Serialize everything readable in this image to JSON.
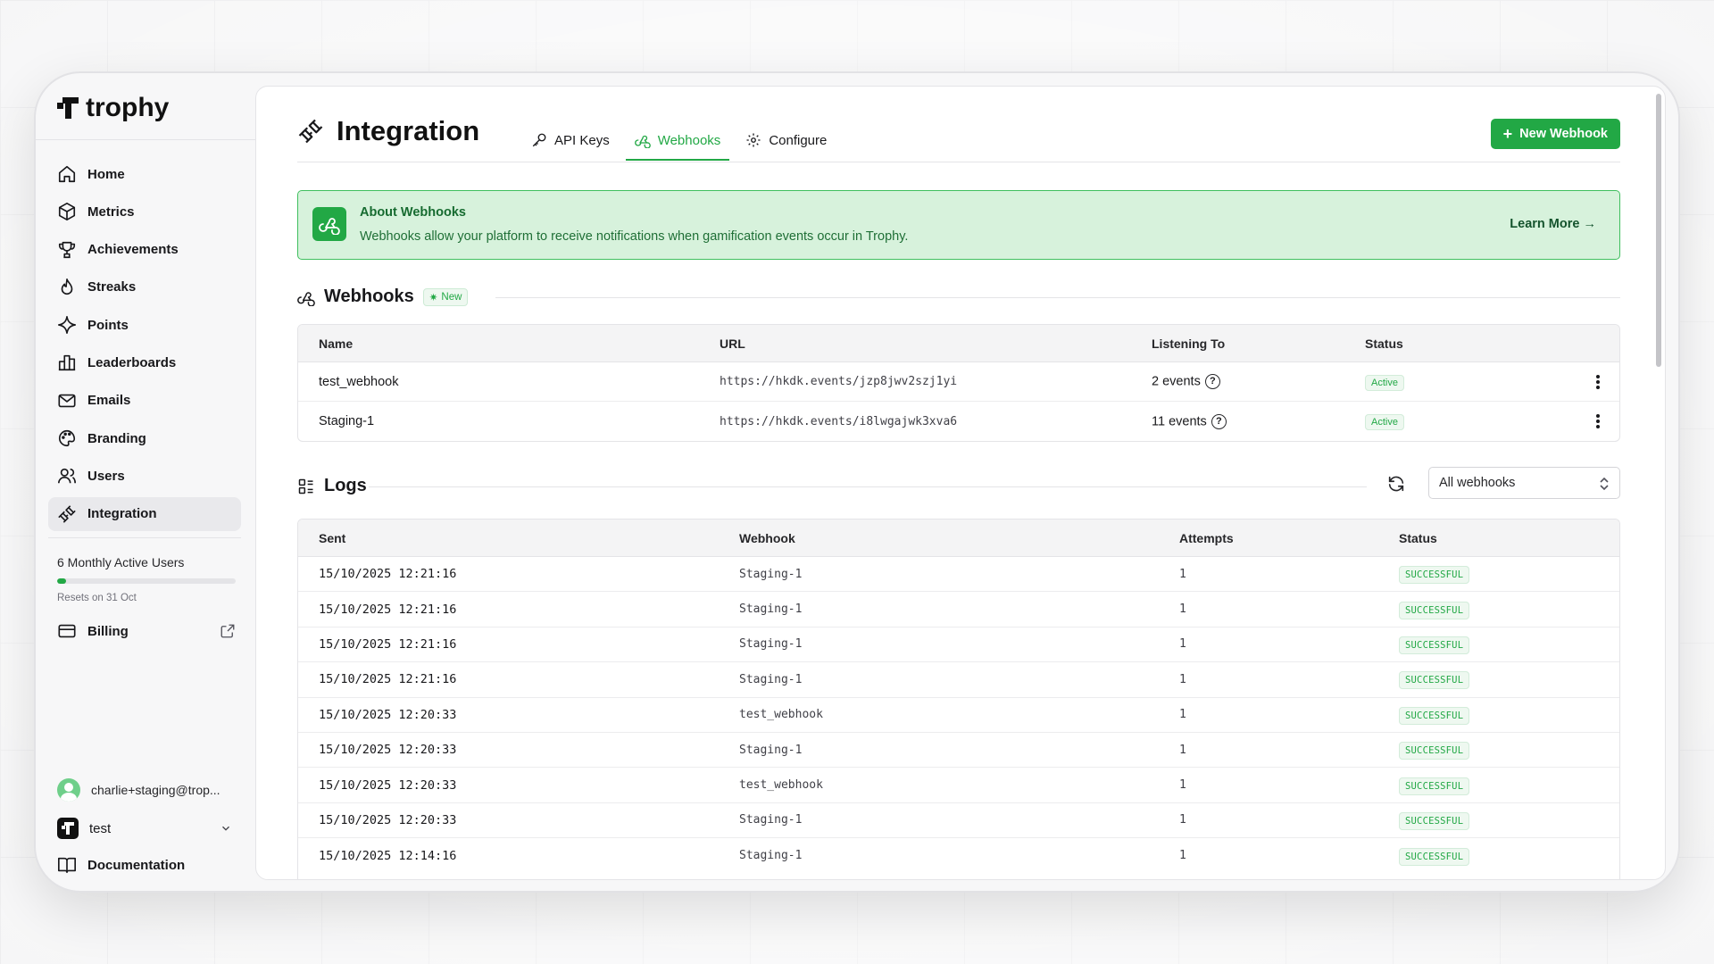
{
  "app": {
    "name": "trophy"
  },
  "colors": {
    "accent": "#22a845",
    "banner_bg": "#d7f2dc"
  },
  "sidebar": {
    "items": [
      {
        "label": "Home",
        "icon": "home-icon"
      },
      {
        "label": "Metrics",
        "icon": "cube-icon"
      },
      {
        "label": "Achievements",
        "icon": "trophy-icon"
      },
      {
        "label": "Streaks",
        "icon": "flame-icon"
      },
      {
        "label": "Points",
        "icon": "sparkle-icon"
      },
      {
        "label": "Leaderboards",
        "icon": "podium-icon"
      },
      {
        "label": "Emails",
        "icon": "mail-icon"
      },
      {
        "label": "Branding",
        "icon": "palette-icon"
      },
      {
        "label": "Users",
        "icon": "users-icon"
      },
      {
        "label": "Integration",
        "icon": "plug-icon",
        "active": true
      }
    ],
    "usage": {
      "label": "6 Monthly Active Users",
      "reset": "Resets on 31 Oct",
      "progress_pct": 5
    },
    "billing": {
      "label": "Billing"
    },
    "user_email": "charlie+staging@trop...",
    "project": "test",
    "docs": "Documentation"
  },
  "header": {
    "title": "Integration",
    "tabs": [
      {
        "label": "API Keys",
        "icon": "key-icon"
      },
      {
        "label": "Webhooks",
        "icon": "webhook-icon",
        "active": true
      },
      {
        "label": "Configure",
        "icon": "gear-icon"
      }
    ],
    "new_button": "New Webhook"
  },
  "banner": {
    "title": "About Webhooks",
    "text": "Webhooks allow your platform to receive notifications when gamification events occur in Trophy.",
    "link": "Learn More"
  },
  "webhooks": {
    "title": "Webhooks",
    "badge": "New",
    "columns": [
      "Name",
      "URL",
      "Listening To",
      "Status"
    ],
    "rows": [
      {
        "name": "test_webhook",
        "url": "https://hkdk.events/jzp8jwv2szj1yi",
        "listening": "2 events",
        "status": "Active"
      },
      {
        "name": "Staging-1",
        "url": "https://hkdk.events/i8lwgajwk3xva6",
        "listening": "11 events",
        "status": "Active"
      }
    ]
  },
  "logs": {
    "title": "Logs",
    "filter": "All webhooks",
    "columns": [
      "Sent",
      "Webhook",
      "Attempts",
      "Status"
    ],
    "rows": [
      {
        "sent": "15/10/2025 12:21:16",
        "webhook": "Staging-1",
        "attempts": "1",
        "status": "SUCCESSFUL"
      },
      {
        "sent": "15/10/2025 12:21:16",
        "webhook": "Staging-1",
        "attempts": "1",
        "status": "SUCCESSFUL"
      },
      {
        "sent": "15/10/2025 12:21:16",
        "webhook": "Staging-1",
        "attempts": "1",
        "status": "SUCCESSFUL"
      },
      {
        "sent": "15/10/2025 12:21:16",
        "webhook": "Staging-1",
        "attempts": "1",
        "status": "SUCCESSFUL"
      },
      {
        "sent": "15/10/2025 12:20:33",
        "webhook": "test_webhook",
        "attempts": "1",
        "status": "SUCCESSFUL"
      },
      {
        "sent": "15/10/2025 12:20:33",
        "webhook": "Staging-1",
        "attempts": "1",
        "status": "SUCCESSFUL"
      },
      {
        "sent": "15/10/2025 12:20:33",
        "webhook": "test_webhook",
        "attempts": "1",
        "status": "SUCCESSFUL"
      },
      {
        "sent": "15/10/2025 12:20:33",
        "webhook": "Staging-1",
        "attempts": "1",
        "status": "SUCCESSFUL"
      },
      {
        "sent": "15/10/2025 12:14:16",
        "webhook": "Staging-1",
        "attempts": "1",
        "status": "SUCCESSFUL"
      }
    ]
  }
}
